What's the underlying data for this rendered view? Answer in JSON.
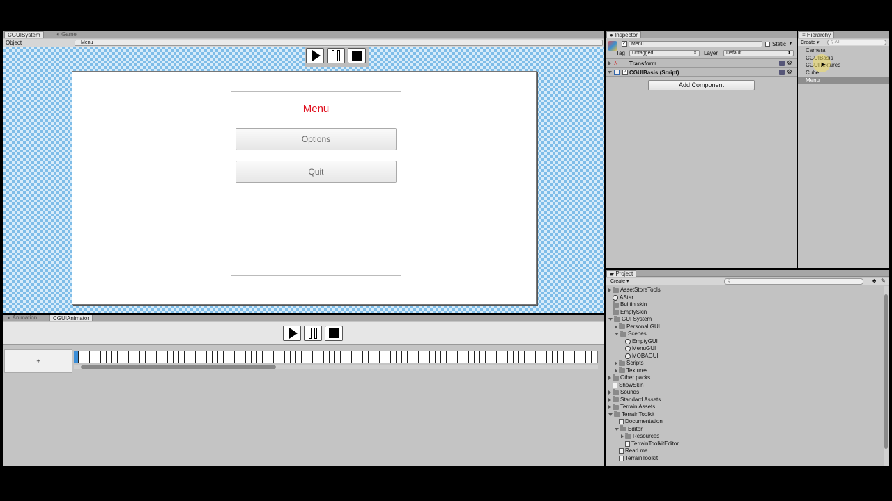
{
  "scene_view": {
    "tabs": [
      {
        "label": "CGUISystem"
      },
      {
        "label": "Game"
      }
    ],
    "object_label": "Object :",
    "object_value": "Menu",
    "menu_panel": {
      "title": "Menu",
      "title_color": "#e0101e",
      "buttons": [
        {
          "label": "Options"
        },
        {
          "label": "Quit"
        }
      ]
    }
  },
  "animation_panel": {
    "tabs": [
      {
        "label": "Animation"
      },
      {
        "label": "CGUIAnimator"
      }
    ],
    "add_label": "+"
  },
  "inspector": {
    "tab_label": "Inspector",
    "object_name": "Menu",
    "static_label": "Static",
    "tag_label": "Tag",
    "tag_value": "Untagged",
    "layer_label": "Layer",
    "layer_value": "Default",
    "components": [
      {
        "label": "Transform"
      },
      {
        "label": "CGUIBasis (Script)"
      }
    ],
    "add_component_label": "Add Component"
  },
  "hierarchy": {
    "tab_label": "Hierarchy",
    "create_label": "Create",
    "search_placeholder": "All",
    "items": [
      {
        "label": "Camera",
        "selected": false
      },
      {
        "label": "CGUIBasis",
        "selected": false
      },
      {
        "label": "CGUITextures",
        "selected": false
      },
      {
        "label": "Cube",
        "selected": false
      },
      {
        "label": "Menu",
        "selected": true
      }
    ]
  },
  "project": {
    "tab_label": "Project",
    "create_label": "Create",
    "items": [
      {
        "label": "AssetStoreTools",
        "icon": "folder-icon",
        "fold": "closed",
        "depth": 0
      },
      {
        "label": "AStar",
        "icon": "scene-icon",
        "fold": "",
        "depth": 0
      },
      {
        "label": "Builtin skin",
        "icon": "folder-icon",
        "fold": "",
        "depth": 0
      },
      {
        "label": "EmptySkin",
        "icon": "folder-icon",
        "fold": "",
        "depth": 0
      },
      {
        "label": "GUI System",
        "icon": "folder-icon",
        "fold": "open",
        "depth": 0
      },
      {
        "label": "Personal GUI",
        "icon": "folder-icon",
        "fold": "closed",
        "depth": 1
      },
      {
        "label": "Scenes",
        "icon": "folder-icon",
        "fold": "open",
        "depth": 1
      },
      {
        "label": "EmptyGUI",
        "icon": "scene-icon",
        "fold": "",
        "depth": 2
      },
      {
        "label": "MenuGUI",
        "icon": "scene-icon",
        "fold": "",
        "depth": 2
      },
      {
        "label": "MOBAGUI",
        "icon": "scene-icon",
        "fold": "",
        "depth": 2
      },
      {
        "label": "Scripts",
        "icon": "folder-icon",
        "fold": "closed",
        "depth": 1
      },
      {
        "label": "Textures",
        "icon": "folder-icon",
        "fold": "closed",
        "depth": 1
      },
      {
        "label": "Other packs",
        "icon": "folder-icon",
        "fold": "closed",
        "depth": 0
      },
      {
        "label": "ShowSkin",
        "icon": "file-icon",
        "fold": "",
        "depth": 0
      },
      {
        "label": "Sounds",
        "icon": "folder-icon",
        "fold": "closed",
        "depth": 0
      },
      {
        "label": "Standard Assets",
        "icon": "folder-icon",
        "fold": "closed",
        "depth": 0
      },
      {
        "label": "Terrain Assets",
        "icon": "folder-icon",
        "fold": "closed",
        "depth": 0
      },
      {
        "label": "TerrainToolkit",
        "icon": "folder-icon",
        "fold": "open",
        "depth": 0
      },
      {
        "label": "Documentation",
        "icon": "file-icon",
        "fold": "",
        "depth": 1
      },
      {
        "label": "Editor",
        "icon": "folder-icon",
        "fold": "open",
        "depth": 1
      },
      {
        "label": "Resources",
        "icon": "folder-icon",
        "fold": "closed",
        "depth": 2
      },
      {
        "label": "TerrainToolkitEditor",
        "icon": "file-icon",
        "fold": "",
        "depth": 2
      },
      {
        "label": "Read me",
        "icon": "file-icon",
        "fold": "",
        "depth": 1
      },
      {
        "label": "TerrainToolkit",
        "icon": "file-icon",
        "fold": "",
        "depth": 1
      }
    ]
  }
}
